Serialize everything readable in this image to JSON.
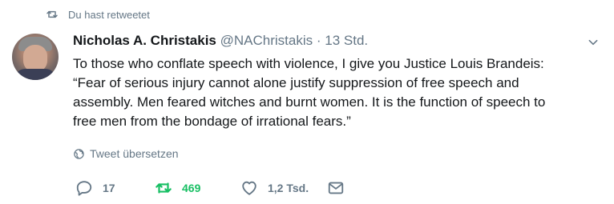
{
  "context": {
    "label": "Du hast retweetet",
    "icon": "retweet-icon"
  },
  "author": {
    "name": "Nicholas A. Christakis",
    "handle": "@NAChristakis",
    "separator": "·",
    "time": "13 Std."
  },
  "tweet": {
    "lines": [
      "To those who conflate speech with violence, I give you Justice Louis Brandeis:",
      "“Fear of serious injury cannot alone justify suppression of free speech and",
      "assembly. Men feared witches and burnt women. It is the function of speech to",
      "free men from the bondage of irrational fears.”"
    ]
  },
  "translate": {
    "label": "Tweet übersetzen",
    "icon": "globe-icon"
  },
  "actions": {
    "reply_count": "17",
    "retweet_count": "469",
    "like_count": "1,2 Tsd."
  },
  "colors": {
    "retweet_active": "#17bf63",
    "muted": "#657786",
    "text": "#14171a"
  }
}
